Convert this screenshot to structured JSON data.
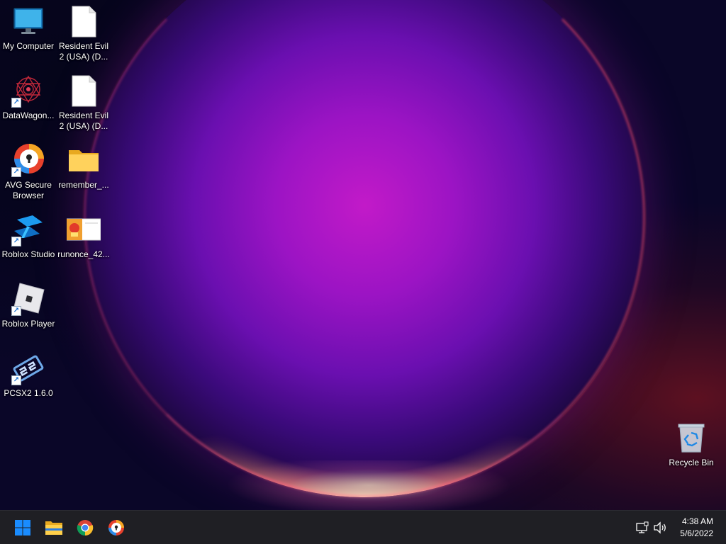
{
  "desktop": {
    "icons": [
      {
        "label": "My Computer",
        "icon": "monitor-icon"
      },
      {
        "label": "Resident Evil\n2 (USA) (D...",
        "icon": "file-icon"
      },
      {
        "label": "DataWagon...",
        "icon": "datawagon-icon"
      },
      {
        "label": "Resident Evil\n2 (USA) (D...",
        "icon": "file-icon"
      },
      {
        "label": "AVG Secure\nBrowser",
        "icon": "avg-browser-icon"
      },
      {
        "label": "remember_...",
        "icon": "folder-icon"
      },
      {
        "label": "Roblox Studio",
        "icon": "roblox-studio-icon"
      },
      {
        "label": "runonce_42...",
        "icon": "image-thumbnail-icon"
      },
      {
        "label": "Roblox Player",
        "icon": "roblox-player-icon"
      },
      {
        "label": "PCSX2 1.6.0",
        "icon": "pcsx2-icon"
      },
      {
        "label": "Recycle Bin",
        "icon": "recycle-bin-icon"
      }
    ]
  },
  "taskbar": {
    "pinned": [
      "start-icon",
      "file-explorer-icon",
      "chrome-icon",
      "avg-browser-icon"
    ],
    "tray": [
      "network-icon",
      "volume-icon"
    ],
    "clock": {
      "time": "4:38 AM",
      "date": "5/6/2022"
    }
  },
  "colors": {
    "taskbar": "#1f1f24",
    "accent": "#1a8cff"
  }
}
